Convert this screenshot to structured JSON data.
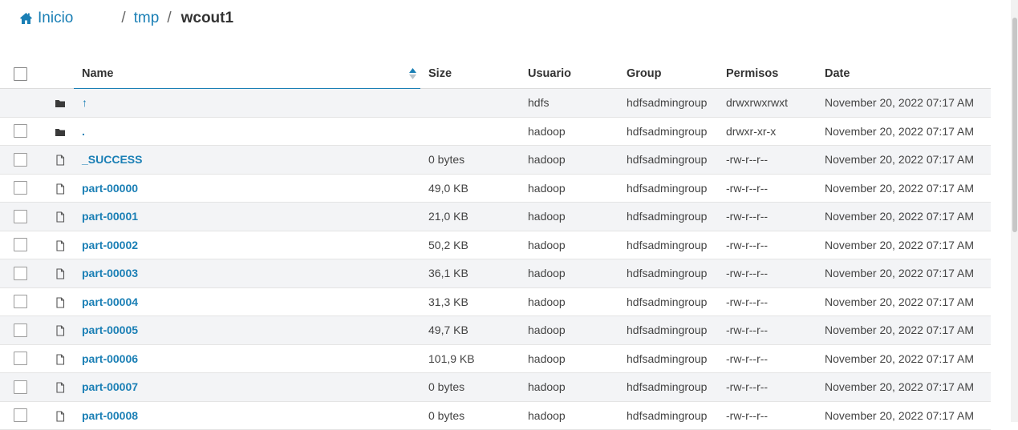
{
  "breadcrumb": {
    "home_label": "Inicio",
    "path": [
      "tmp",
      "wcout1"
    ],
    "separator": "/"
  },
  "table": {
    "columns": {
      "name": "Name",
      "size": "Size",
      "user": "Usuario",
      "group": "Group",
      "permissions": "Permisos",
      "date": "Date"
    },
    "sort": {
      "column": "Name",
      "direction": "ascending"
    },
    "rows": [
      {
        "type": "folder",
        "name": "↑",
        "size": "",
        "user": "hdfs",
        "group": "hdfsadmingroup",
        "permissions": "drwxrwxrwxt",
        "date": "November 20, 2022 07:17 AM",
        "has_checkbox": false
      },
      {
        "type": "folder",
        "name": ".",
        "size": "",
        "user": "hadoop",
        "group": "hdfsadmingroup",
        "permissions": "drwxr-xr-x",
        "date": "November 20, 2022 07:17 AM",
        "has_checkbox": true
      },
      {
        "type": "file",
        "name": "_SUCCESS",
        "size": "0 bytes",
        "user": "hadoop",
        "group": "hdfsadmingroup",
        "permissions": "-rw-r--r--",
        "date": "November 20, 2022 07:17 AM",
        "has_checkbox": true
      },
      {
        "type": "file",
        "name": "part-00000",
        "size": "49,0 KB",
        "user": "hadoop",
        "group": "hdfsadmingroup",
        "permissions": "-rw-r--r--",
        "date": "November 20, 2022 07:17 AM",
        "has_checkbox": true
      },
      {
        "type": "file",
        "name": "part-00001",
        "size": "21,0 KB",
        "user": "hadoop",
        "group": "hdfsadmingroup",
        "permissions": "-rw-r--r--",
        "date": "November 20, 2022 07:17 AM",
        "has_checkbox": true
      },
      {
        "type": "file",
        "name": "part-00002",
        "size": "50,2 KB",
        "user": "hadoop",
        "group": "hdfsadmingroup",
        "permissions": "-rw-r--r--",
        "date": "November 20, 2022 07:17 AM",
        "has_checkbox": true
      },
      {
        "type": "file",
        "name": "part-00003",
        "size": "36,1 KB",
        "user": "hadoop",
        "group": "hdfsadmingroup",
        "permissions": "-rw-r--r--",
        "date": "November 20, 2022 07:17 AM",
        "has_checkbox": true
      },
      {
        "type": "file",
        "name": "part-00004",
        "size": "31,3 KB",
        "user": "hadoop",
        "group": "hdfsadmingroup",
        "permissions": "-rw-r--r--",
        "date": "November 20, 2022 07:17 AM",
        "has_checkbox": true
      },
      {
        "type": "file",
        "name": "part-00005",
        "size": "49,7 KB",
        "user": "hadoop",
        "group": "hdfsadmingroup",
        "permissions": "-rw-r--r--",
        "date": "November 20, 2022 07:17 AM",
        "has_checkbox": true
      },
      {
        "type": "file",
        "name": "part-00006",
        "size": "101,9 KB",
        "user": "hadoop",
        "group": "hdfsadmingroup",
        "permissions": "-rw-r--r--",
        "date": "November 20, 2022 07:17 AM",
        "has_checkbox": true
      },
      {
        "type": "file",
        "name": "part-00007",
        "size": "0 bytes",
        "user": "hadoop",
        "group": "hdfsadmingroup",
        "permissions": "-rw-r--r--",
        "date": "November 20, 2022 07:17 AM",
        "has_checkbox": true
      },
      {
        "type": "file",
        "name": "part-00008",
        "size": "0 bytes",
        "user": "hadoop",
        "group": "hdfsadmingroup",
        "permissions": "-rw-r--r--",
        "date": "November 20, 2022 07:17 AM",
        "has_checkbox": true
      }
    ]
  },
  "colors": {
    "link": "#1a7fb5",
    "stripe": "#f3f4f6",
    "header_text": "#333333"
  },
  "icons": {
    "home": "home-icon",
    "folder": "folder-icon",
    "file": "file-icon",
    "sort": "sort-icon"
  }
}
